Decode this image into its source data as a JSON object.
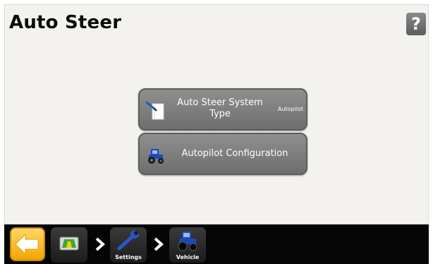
{
  "page": {
    "title": "Auto Steer",
    "help_label": "?"
  },
  "menu": {
    "items": [
      {
        "label": "Auto Steer System Type",
        "value": "Autopilot",
        "icon": "document-pen-icon"
      },
      {
        "label": "Autopilot Configuration",
        "icon": "tractor-icon"
      }
    ]
  },
  "nav": {
    "back_icon": "back-arrow-icon",
    "breadcrumbs": [
      {
        "label": "",
        "icon": "home-screen-icon"
      },
      {
        "label": "Settings",
        "icon": "wrench-icon"
      },
      {
        "label": "Vehicle",
        "icon": "tractor-icon"
      }
    ]
  },
  "colors": {
    "accent": "#f2a400",
    "button": "#808080",
    "bottom_bar": "#050505",
    "tractor": "#1d49b8"
  }
}
